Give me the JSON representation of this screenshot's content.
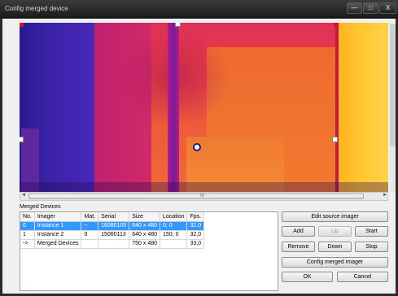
{
  "window": {
    "title": "Config merged device",
    "minimize_glyph": "—",
    "maximize_glyph": "□",
    "close_glyph": "X"
  },
  "viewer": {
    "scroll_grip": "III",
    "scroll_left": "◄",
    "scroll_right": "►"
  },
  "merged_devices": {
    "group_label": "Merged Devices",
    "columns": [
      "No.",
      "Imager",
      "Mat.",
      "Serial",
      "Size",
      "Location",
      "Fps."
    ],
    "rows": [
      {
        "no": "0",
        "imager": "Instance 1",
        "mat": "~",
        "serial": "16080100",
        "size": "640 x 480",
        "location": "0; 0",
        "fps": "32,0",
        "selected": true
      },
      {
        "no": "1",
        "imager": "Instance 2",
        "mat": "0",
        "serial": "15060113",
        "size": "640 x 480",
        "location": "150; 0",
        "fps": "32,0",
        "selected": false
      },
      {
        "no": "->",
        "imager": "Merged Devices",
        "mat": "",
        "serial": "",
        "size": "750 x 480",
        "location": "",
        "fps": "33,0",
        "selected": false
      }
    ]
  },
  "buttons": {
    "edit_source_imager": "Edit source imager",
    "add": "Add",
    "up": "Up",
    "start": "Start",
    "remove": "Remove",
    "down": "Down",
    "stop": "Stop",
    "config_merged_imager": "Config merged imager",
    "ok": "OK",
    "cancel": "Cancel"
  },
  "colors": {
    "selection": "#3399ff",
    "handle_outline": "#1a1a90"
  }
}
